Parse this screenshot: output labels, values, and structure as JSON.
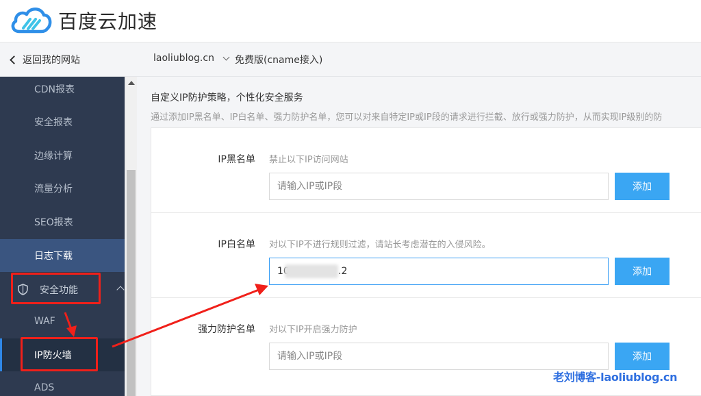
{
  "header": {
    "brand": "百度云加速"
  },
  "subbar": {
    "back_label": "返回我的网站",
    "domain": "laoliublog.cn",
    "plan": "免费版(cname接入)"
  },
  "sidebar": {
    "items": [
      {
        "label": "CDN报表"
      },
      {
        "label": "安全报表"
      },
      {
        "label": "边缘计算"
      },
      {
        "label": "流量分析"
      },
      {
        "label": "SEO报表"
      },
      {
        "label": "日志下载"
      }
    ],
    "group": {
      "label": "安全功能",
      "icon": "shield-icon"
    },
    "sub_items": [
      {
        "label": "WAF"
      },
      {
        "label": "IP防火墙"
      },
      {
        "label": "ADS"
      }
    ]
  },
  "main": {
    "title": "自定义IP防护策略，个性化安全服务",
    "description": "通过添加IP黑名单、IP白名单、强力防护名单，您可以对来自特定IP或IP段的请求进行拦截、放行或强力防护，从而实现IP级别的防",
    "sections": [
      {
        "label": "IP黑名单",
        "hint": "禁止以下IP访问网站",
        "value": "",
        "placeholder": "请输入IP或IP段",
        "button": "添加"
      },
      {
        "label": "IP白名单",
        "hint": "对以下IP不进行规则过滤，请站长考虑潜在的入侵风险。",
        "value": "10                .2",
        "placeholder": "请输入IP或IP段",
        "button": "添加"
      },
      {
        "label": "强力防护名单",
        "hint": "对以下IP开启强力防护",
        "value": "",
        "placeholder": "请输入IP或IP段",
        "button": "添加"
      }
    ]
  },
  "watermark": "老刘博客-laoliublog.cn",
  "colors": {
    "sidebar_bg": "#2e3a50",
    "accent": "#3aa6f3",
    "annotation_red": "#f0201a",
    "watermark": "#2f6fe0"
  }
}
